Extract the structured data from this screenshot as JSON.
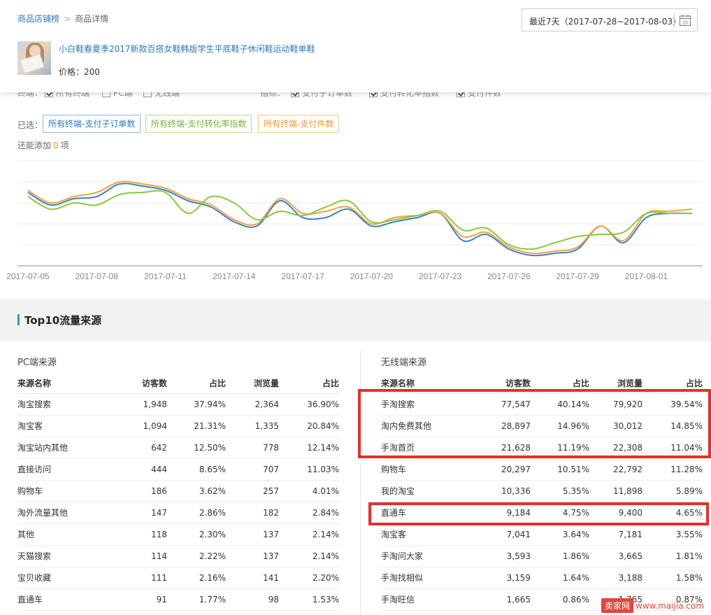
{
  "breadcrumb": {
    "parent": "商品店铺榜",
    "separator": ">",
    "current": "商品详情"
  },
  "date_range": {
    "label": "最近7天（2017-07-28~2017-08-03）",
    "calendar_day": "15"
  },
  "product": {
    "title": "小白鞋春夏季2017新款百搭女鞋韩版学生平底鞋子休闲鞋运动鞋单鞋",
    "price_label": "价格：200"
  },
  "filters": {
    "terminal_label": "终端：",
    "terminal_options": [
      {
        "label": "所有终端",
        "checked": true
      },
      {
        "label": "PC端",
        "checked": false
      },
      {
        "label": "无线端",
        "checked": false
      }
    ],
    "metric_label": "指标：",
    "metric_options": [
      {
        "label": "支付子订单数",
        "checked": true
      },
      {
        "label": "支付转化率指数",
        "checked": true
      },
      {
        "label": "支付件数",
        "checked": true
      }
    ]
  },
  "selected": {
    "label": "已选：",
    "tags": [
      {
        "label": "所有终端-支付子订单数",
        "color": "#3a7fd0"
      },
      {
        "label": "所有终端-支付转化率指数",
        "color": "#8cc63f"
      },
      {
        "label": "所有终端-支付件数",
        "color": "#f2a23a"
      }
    ],
    "addable_prefix": "还能添加",
    "addable_count": "0",
    "addable_suffix": "项"
  },
  "chart_data": {
    "type": "line",
    "x_ticks": [
      "2017-07-05",
      "2017-07-08",
      "2017-07-11",
      "2017-07-14",
      "2017-07-17",
      "2017-07-20",
      "2017-07-23",
      "2017-07-26",
      "2017-07-29",
      "2017-08-01"
    ],
    "x": [
      "2017-07-05",
      "2017-07-06",
      "2017-07-07",
      "2017-07-08",
      "2017-07-09",
      "2017-07-10",
      "2017-07-11",
      "2017-07-12",
      "2017-07-13",
      "2017-07-14",
      "2017-07-15",
      "2017-07-16",
      "2017-07-17",
      "2017-07-18",
      "2017-07-19",
      "2017-07-20",
      "2017-07-21",
      "2017-07-22",
      "2017-07-23",
      "2017-07-24",
      "2017-07-25",
      "2017-07-26",
      "2017-07-27",
      "2017-07-28",
      "2017-07-29",
      "2017-07-30",
      "2017-07-31",
      "2017-08-01",
      "2017-08-02",
      "2017-08-03"
    ],
    "ylim": [
      0,
      5
    ],
    "grid": true,
    "series": [
      {
        "color": "#3a7fd0",
        "values": [
          3.5,
          2.9,
          3.2,
          3.3,
          3.9,
          3.8,
          3.6,
          3.1,
          2.8,
          2.1,
          1.9,
          3.1,
          2.3,
          2.3,
          2.7,
          1.9,
          2.1,
          2.3,
          2.5,
          1.2,
          1.5,
          0.8,
          0.5,
          0.6,
          0.8,
          1.9,
          1.1,
          2.3,
          2.5,
          2.5
        ]
      },
      {
        "color": "#f2a23a",
        "values": [
          3.6,
          3.0,
          3.3,
          3.5,
          4.0,
          3.9,
          3.7,
          3.2,
          2.9,
          2.2,
          2.0,
          3.2,
          2.5,
          2.6,
          2.8,
          2.0,
          2.3,
          2.4,
          2.5,
          1.4,
          1.6,
          0.9,
          0.6,
          0.7,
          0.9,
          1.9,
          1.2,
          2.5,
          2.6,
          2.7
        ]
      },
      {
        "color": "#8cc63f",
        "values": [
          3.3,
          2.7,
          3.0,
          2.9,
          3.4,
          3.5,
          3.5,
          2.5,
          3.3,
          3.0,
          2.2,
          2.6,
          2.4,
          2.8,
          3.1,
          2.1,
          2.2,
          2.4,
          2.6,
          1.7,
          1.8,
          1.0,
          0.8,
          1.1,
          1.4,
          1.5,
          1.6,
          2.5,
          2.5,
          2.5
        ]
      }
    ]
  },
  "section": {
    "title": "Top10流量来源"
  },
  "pc_table": {
    "title": "PC端来源",
    "headers": [
      "来源名称",
      "访客数",
      "占比",
      "浏览量",
      "占比"
    ],
    "rows": [
      [
        "淘宝搜索",
        "1,948",
        "37.94%",
        "2,364",
        "36.90%"
      ],
      [
        "淘宝客",
        "1,094",
        "21.31%",
        "1,335",
        "20.84%"
      ],
      [
        "淘宝站内其他",
        "642",
        "12.50%",
        "778",
        "12.14%"
      ],
      [
        "直接访问",
        "444",
        "8.65%",
        "707",
        "11.03%"
      ],
      [
        "购物车",
        "186",
        "3.62%",
        "257",
        "4.01%"
      ],
      [
        "淘外流量其他",
        "147",
        "2.86%",
        "182",
        "2.84%"
      ],
      [
        "其他",
        "118",
        "2.30%",
        "137",
        "2.14%"
      ],
      [
        "天猫搜索",
        "114",
        "2.22%",
        "137",
        "2.14%"
      ],
      [
        "宝贝收藏",
        "111",
        "2.16%",
        "141",
        "2.20%"
      ],
      [
        "直通车",
        "91",
        "1.77%",
        "98",
        "1.53%"
      ]
    ]
  },
  "mobile_table": {
    "title": "无线端来源",
    "headers": [
      "来源名称",
      "访客数",
      "占比",
      "浏览量",
      "占比"
    ],
    "rows": [
      [
        "手淘搜索",
        "77,547",
        "40.14%",
        "79,920",
        "39.54%"
      ],
      [
        "淘内免费其他",
        "28,897",
        "14.96%",
        "30,012",
        "14.85%"
      ],
      [
        "手淘首页",
        "21,628",
        "11.19%",
        "22,308",
        "11.04%"
      ],
      [
        "购物车",
        "20,297",
        "10.51%",
        "22,792",
        "11.28%"
      ],
      [
        "我的淘宝",
        "10,336",
        "5.35%",
        "11,898",
        "5.89%"
      ],
      [
        "直通车",
        "9,184",
        "4.75%",
        "9,400",
        "4.65%"
      ],
      [
        "淘宝客",
        "7,041",
        "3.64%",
        "7,181",
        "3.55%"
      ],
      [
        "手淘问大家",
        "3,593",
        "1.86%",
        "3,665",
        "1.81%"
      ],
      [
        "手淘找相似",
        "3,159",
        "1.64%",
        "3,188",
        "1.58%"
      ],
      [
        "手淘旺信",
        "1,665",
        "0.86%",
        "1,765",
        "0.87%"
      ]
    ]
  },
  "watermark": {
    "badge": "卖家网",
    "url": "www.maijia.com"
  }
}
